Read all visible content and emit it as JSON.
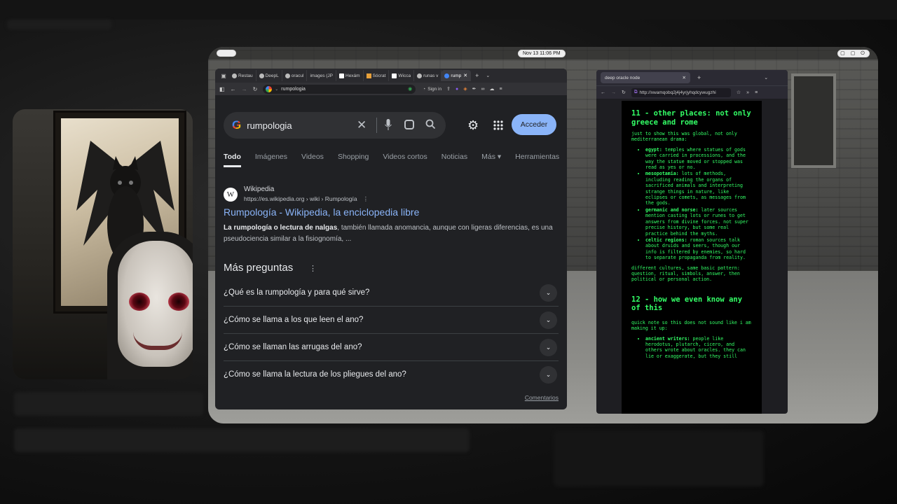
{
  "top_bar": {
    "clock": "Nov 13  11:06 PM"
  },
  "left_browser": {
    "tabs": [
      {
        "label": "Restau"
      },
      {
        "label": "DeepL"
      },
      {
        "label": "oracul"
      },
      {
        "label": "images (JP"
      },
      {
        "label": "Hexám"
      },
      {
        "label": "Sócrat"
      },
      {
        "label": "Wicca"
      },
      {
        "label": "runas v"
      },
      {
        "label": "rump"
      }
    ],
    "url": "rumpologia",
    "sign_in": "Sign in",
    "search": {
      "query": "rumpologia",
      "acceder": "Acceder"
    },
    "search_tabs": [
      "Todo",
      "Imágenes",
      "Videos",
      "Shopping",
      "Videos cortos",
      "Noticias",
      "Más ▾",
      "Herramientas"
    ],
    "result": {
      "site_name": "Wikipedia",
      "url": "https://es.wikipedia.org › wiki › Rumpología",
      "title": "Rumpología - Wikipedia, la enciclopedia libre",
      "snippet_bold": "La rumpología o lectura de nalgas",
      "snippet_rest": ", también llamada anomancia, aunque con ligeras diferencias, es una pseudociencia similar a la fisiognomía, ..."
    },
    "mas_preguntas": "Más preguntas",
    "questions": [
      "¿Qué es la rumpología y para qué sirve?",
      "¿Cómo se llama a los que leen el ano?",
      "¿Cómo se llaman las arrugas del ano?",
      "¿Cómo se llama la lectura de los pliegues del ano?"
    ],
    "comentarios": "Comentarios"
  },
  "right_browser": {
    "tab_label": "deep oracle node",
    "url": "http://xwamqobq2j4j4yrjyhqdcywugzhi",
    "section11": {
      "title": "11 - other places: not only greece and rome",
      "intro": "just to show this was global, not only mediterranean drama:",
      "items": [
        {
          "term": "egypt:",
          "text": " temples where statues of gods were carried in processions, and the way the statue moved or stopped was read as yes or no."
        },
        {
          "term": "mesopotamia:",
          "text": " lots of methods, including reading the organs of sacrificed animals and interpreting strange things in nature, like eclipses or comets, as messages from the gods."
        },
        {
          "term": "germanic and norse:",
          "text": " later sources mention casting lots or runes to get answers from divine forces. not super precise history, but some real practice behind the myths."
        },
        {
          "term": "celtic regions:",
          "text": " roman sources talk about druids and seers, though our info is filtered by enemies, so hard to separate propaganda from reality."
        }
      ],
      "outro": "different cultures, same basic pattern: question, ritual, simbols, answer, then political or personal action."
    },
    "section12": {
      "title": "12 - how we even know any of this",
      "intro": "quick note so this does not sound like i am making it up:",
      "items": [
        {
          "term": "ancient writers:",
          "text": " people like herodotus, plutarch, cicero, and others wrote about oracles. they can lie or exaggerate, but they still"
        }
      ]
    }
  }
}
